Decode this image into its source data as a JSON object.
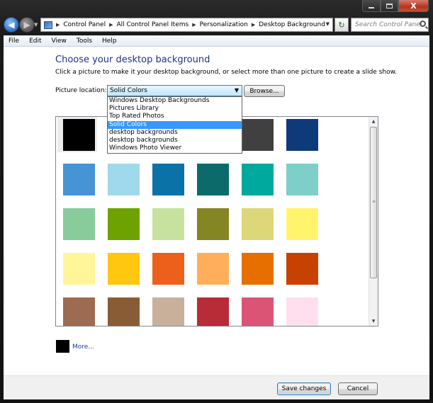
{
  "window": {
    "caption_close": "X"
  },
  "nav": {
    "back_glyph": "◀",
    "forward_glyph": "▶",
    "dropdown_glyph": "▼",
    "breadcrumbs": [
      "Control Panel",
      "All Control Panel Items",
      "Personalization",
      "Desktop Background"
    ],
    "refresh_glyph": "↻",
    "search_placeholder": "Search Control Panel"
  },
  "menu": [
    "File",
    "Edit",
    "View",
    "Tools",
    "Help"
  ],
  "main": {
    "title": "Choose your desktop background",
    "subtitle": "Click a picture to make it your desktop background, or select more than one picture to create a slide show.",
    "location_label": "Picture location:",
    "location_value": "Solid Colors",
    "browse_label": "Browse...",
    "dropdown_options": [
      "Windows Desktop Backgrounds",
      "Pictures Library",
      "Top Rated Photos",
      "Solid Colors",
      "desktop backgrounds",
      "desktop backgrounds",
      "Windows Photo Viewer"
    ],
    "dropdown_selected_index": 3,
    "colors": [
      [
        "#000000",
        "#5f5f5f",
        "#a0a0a0",
        "#cccccc",
        "#404040",
        "#0e3a7a"
      ],
      [
        "#4694d4",
        "#a0d8ec",
        "#0a72a6",
        "#0d6a6a",
        "#00a99d",
        "#7ecfc9"
      ],
      [
        "#88cc9c",
        "#6ea200",
        "#c7e29e",
        "#838623",
        "#dcd778",
        "#fff46c"
      ],
      [
        "#fff69a",
        "#ffc70e",
        "#ec601c",
        "#ffae5c",
        "#e66f00",
        "#c74200"
      ],
      [
        "#9c6b52",
        "#8a5c35",
        "#c8b09b",
        "#b72c37",
        "#db5475",
        "#ffdfee"
      ]
    ],
    "more_label": "More..."
  },
  "footer": {
    "save_label": "Save changes",
    "cancel_label": "Cancel"
  }
}
